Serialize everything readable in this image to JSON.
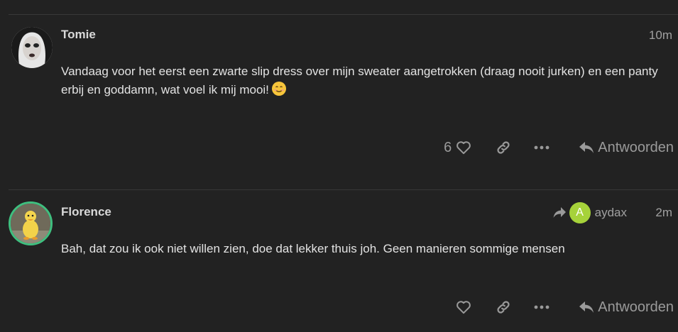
{
  "posts": [
    {
      "username": "Tomie",
      "time": "10m",
      "body": "Vandaag voor het eerst een zwarte slip dress over mijn sweater aangetrokken (draag nooit jurken) en een panty erbij en goddamn, wat voel ik mij mooi!",
      "emoji_icon": "smiling-face-emoji",
      "like_count": "6",
      "reply_label": "Antwoorden"
    },
    {
      "username": "Florence",
      "time": "2m",
      "reply_to": {
        "initial": "A",
        "username": "aydax",
        "color": "#a6d23a"
      },
      "body": "Bah, dat zou ik ook niet willen zien, doe dat lekker thuis joh. Geen manieren sommige mensen",
      "reply_label": "Antwoorden"
    }
  ],
  "colors": {
    "background": "#222222",
    "text": "#e3e3e3",
    "muted": "#9a9a9a",
    "avatar_ring": "#3fbf7f"
  }
}
